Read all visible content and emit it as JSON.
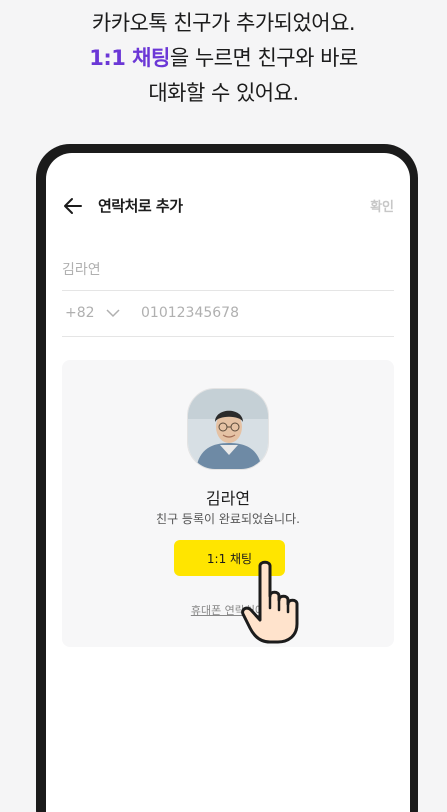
{
  "caption": {
    "line1": "카카오톡 친구가 추가되었어요.",
    "line2_highlight": "1:1 채팅",
    "line2_rest": "을 누르면 친구와 바로",
    "line3": "대화할 수 있어요."
  },
  "appbar": {
    "back_icon": "arrow-left-icon",
    "title": "연락처로 추가",
    "confirm_label": "확인"
  },
  "form": {
    "name_placeholder": "김라연",
    "country_code": "+82",
    "phone_placeholder": "01012345678"
  },
  "friend_card": {
    "name": "김라연",
    "status": "친구 등록이 완료되었습니다.",
    "chat_button_label": "1:1 채팅",
    "link_label": "휴대폰 연락처에"
  },
  "colors": {
    "accent_yellow": "#ffe500",
    "highlight_purple": "#6b37d6",
    "phone_frame": "#1b1b1b"
  }
}
